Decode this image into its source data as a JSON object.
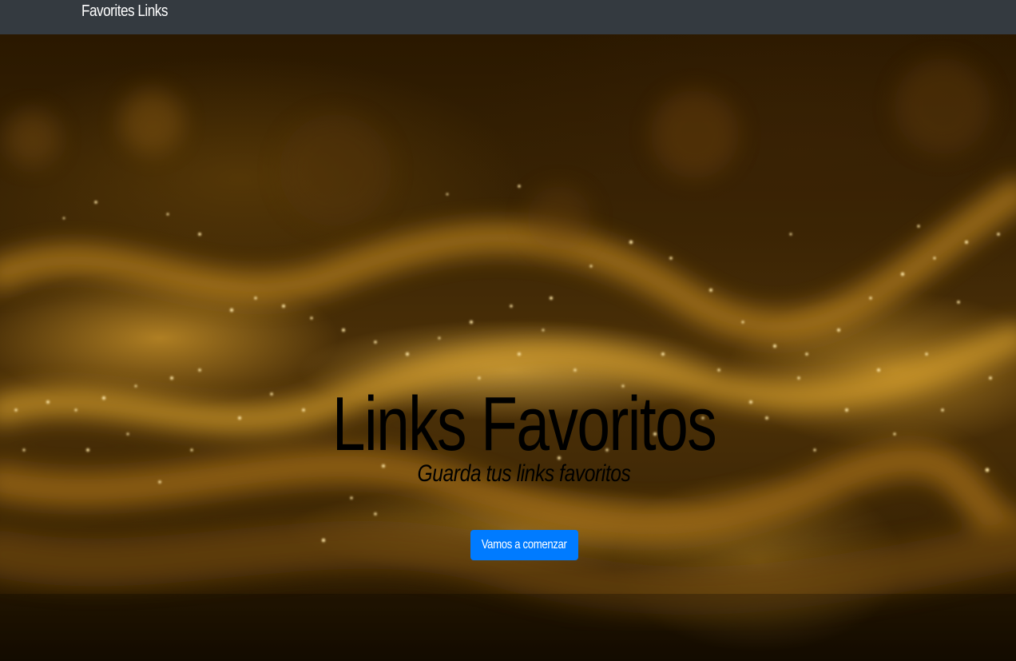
{
  "navbar": {
    "brand": "Favorites Links",
    "background": "#343a40"
  },
  "hero": {
    "title": "Links Favoritos",
    "subtitle": "Guarda tus links favoritos",
    "button_label": "Vamos a comenzar",
    "button_color": "#007bff",
    "background_theme": "golden particle waves"
  }
}
